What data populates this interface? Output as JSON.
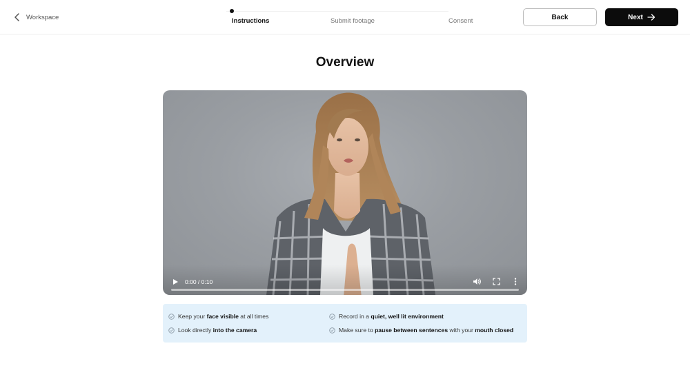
{
  "header": {
    "back_link_label": "Workspace",
    "steps": [
      {
        "label": "Instructions",
        "active": true
      },
      {
        "label": "Submit footage",
        "active": false
      },
      {
        "label": "Consent",
        "active": false
      }
    ],
    "back_button": "Back",
    "next_button": "Next"
  },
  "main": {
    "title": "Overview",
    "video": {
      "time": "0:00 / 0:10",
      "progress": 0.0
    },
    "tips": [
      {
        "pre": "Keep your ",
        "bold": "face visible",
        "post": " at all times"
      },
      {
        "pre": "Record in a ",
        "bold": "quiet, well lit environment",
        "post": ""
      },
      {
        "pre": "Look directly ",
        "bold": "into the camera",
        "post": ""
      },
      {
        "pre": "Make sure to ",
        "bold": "pause between sentences",
        "post": " with your ",
        "bold2": "mouth closed"
      }
    ]
  },
  "colors": {
    "accent": "#0c0c0c",
    "tips_bg": "#e3f1fb",
    "video_bg": "#9a9ea3"
  },
  "icons": [
    "chevron-left-icon",
    "arrow-right-icon",
    "play-icon",
    "volume-icon",
    "fullscreen-icon",
    "more-vertical-icon",
    "check-circle-icon"
  ]
}
